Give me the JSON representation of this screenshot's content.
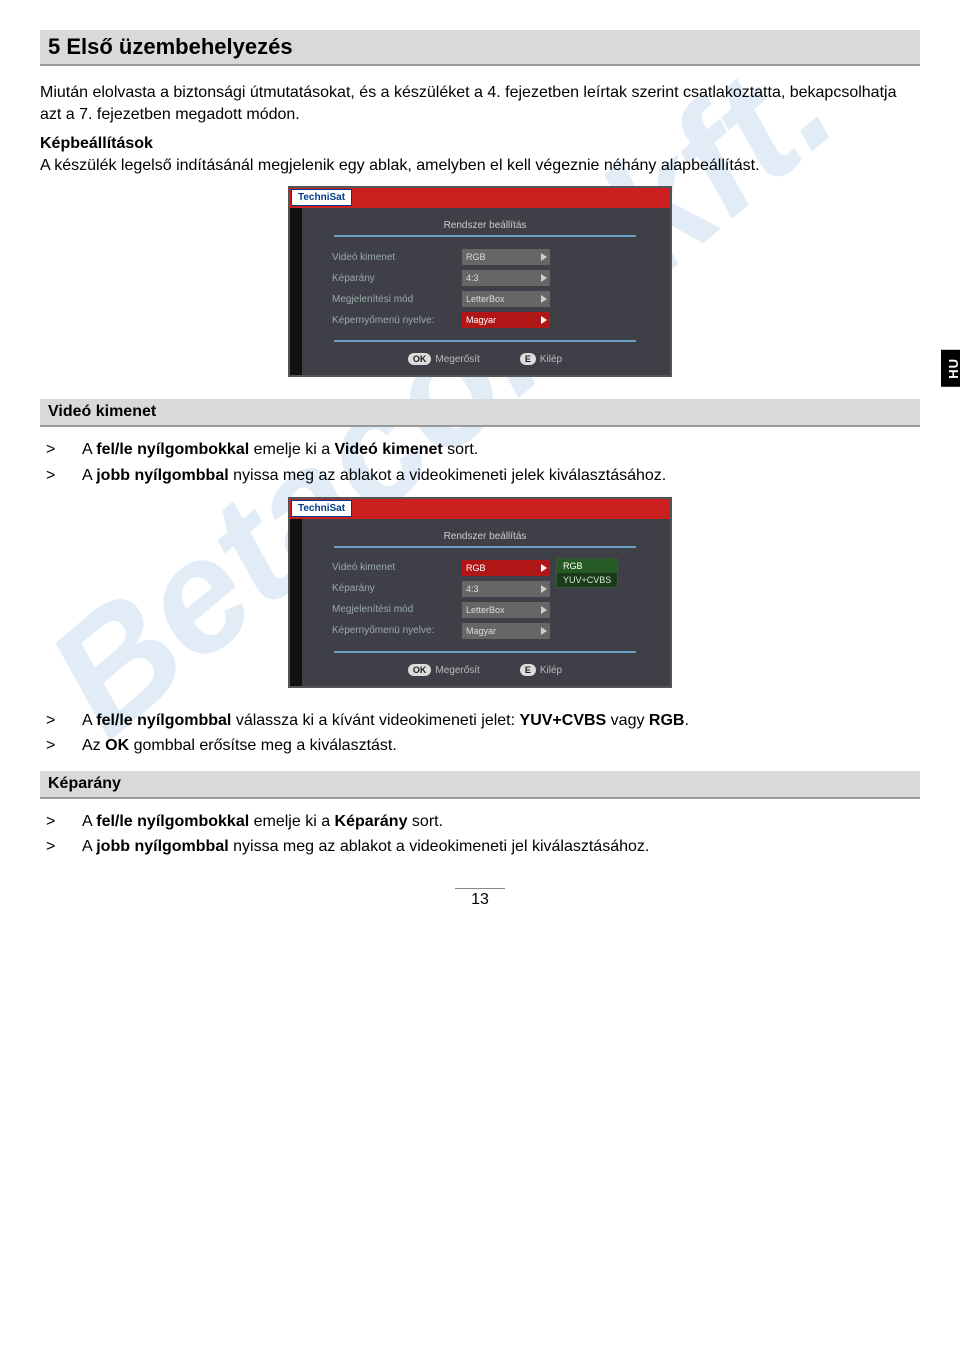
{
  "watermark": "Betacom kft.",
  "tab": "HU",
  "page_number": "13",
  "main_heading": "5 Első üzembehelyezés",
  "intro": {
    "p1_a": "Miután elolvasta a biztonsági útmutatásokat, és a készüléket a 4. fejezetben leírtak szerint csatlakoztatta, bekapcsolhatja azt a 7. fejezetben megadott módon.",
    "kb_label": "Képbeállítások",
    "p2": "A készülék legelső indításánál megjelenik egy ablak, amelyben el kell végeznie néhány alapbeállítást."
  },
  "sections": {
    "video_out": "Videó kimenet",
    "aspect": "Képarány"
  },
  "bullets": {
    "vo1_a": "A ",
    "vo1_b": "fel/le nyílgombokkal",
    "vo1_c": " emelje ki a ",
    "vo1_d": "Videó kimenet",
    "vo1_e": " sort.",
    "vo2_a": "A ",
    "vo2_b": "jobb nyílgombbal",
    "vo2_c": " nyissa meg az ablakot a videokimeneti jelek kiválasztásához.",
    "vo3_a": "A ",
    "vo3_b": "fel/le nyílgombbal",
    "vo3_c": " válassza ki a kívánt videokimeneti jelet: ",
    "vo3_d": "YUV+CVBS",
    "vo3_e": " vagy ",
    "vo3_f": "RGB",
    "vo3_g": ".",
    "vo4_a": "Az ",
    "vo4_b": "OK",
    "vo4_c": " gombbal erősítse meg a kiválasztást.",
    "ar1_a": "A ",
    "ar1_b": "fel/le nyílgombokkal",
    "ar1_c": " emelje ki a ",
    "ar1_d": "Képarány",
    "ar1_e": " sort.",
    "ar2_a": "A ",
    "ar2_b": "jobb nyílgombbal",
    "ar2_c": " nyissa meg az ablakot a videokimeneti jel kiválasztásához."
  },
  "osd": {
    "brand": "TechniSat",
    "title": "Rendszer beállítás",
    "labels": {
      "video": "Videó kimenet",
      "aspect": "Képarány",
      "disp": "Megjelenítési mód",
      "lang": "Képernyőmenü nyelve:"
    },
    "values": {
      "video": "RGB",
      "aspect": "4:3",
      "disp": "LetterBox",
      "lang": "Magyar"
    },
    "popup": {
      "o1": "RGB",
      "o2": "YUV+CVBS"
    },
    "foot": {
      "ok": "OK",
      "ok_lbl": "Megerősít",
      "e": "E",
      "e_lbl": "Kilép"
    }
  }
}
